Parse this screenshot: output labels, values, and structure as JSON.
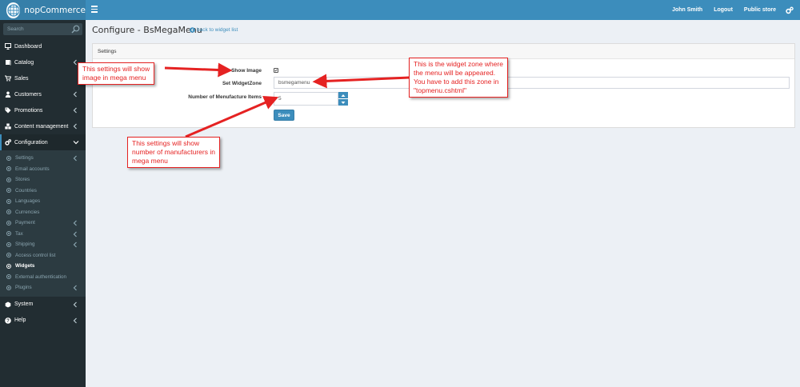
{
  "app": {
    "brand": "nopCommerce"
  },
  "header": {
    "user_name": "John Smith",
    "logout": "Logout",
    "public_store": "Public store"
  },
  "sidebar": {
    "search_placeholder": "Search",
    "items": [
      {
        "label": "Dashboard",
        "icon": "desktop-icon"
      },
      {
        "label": "Catalog",
        "icon": "book-icon"
      },
      {
        "label": "Sales",
        "icon": "cart-icon"
      },
      {
        "label": "Customers",
        "icon": "user-icon"
      },
      {
        "label": "Promotions",
        "icon": "tag-icon"
      },
      {
        "label": "Content management",
        "icon": "cubes-icon"
      },
      {
        "label": "Configuration",
        "icon": "gears-icon"
      },
      {
        "label": "System",
        "icon": "cube-icon"
      },
      {
        "label": "Help",
        "icon": "question-icon"
      }
    ],
    "config_sub": [
      "Settings",
      "Email accounts",
      "Stores",
      "Countries",
      "Languages",
      "Currencies",
      "Payment",
      "Tax",
      "Shipping",
      "Access control list",
      "Widgets",
      "External authentication",
      "Plugins"
    ]
  },
  "page": {
    "title": "Configure - BsMegaMenu",
    "back_link": "back to widget list",
    "panel_heading": "Settings",
    "fields": {
      "show_image_label": "Show Image",
      "show_image_checked": true,
      "widget_zone_label": "Set WidgetZone",
      "widget_zone_value": "bsmegamenu",
      "manufacture_label": "Number of Menufacture Items",
      "manufacture_value": "5"
    },
    "save_label": "Save"
  },
  "callouts": {
    "show_image": [
      "This settings will show",
      "image in mega menu"
    ],
    "widget_zone": [
      "This is the widget zone where",
      "the menu will be appeared.",
      "You have to add this zone in",
      "\"topmenu.cshtml\""
    ],
    "manufacturers": [
      "This settings will show",
      "number of manufacturers in",
      "mega menu"
    ]
  },
  "colors": {
    "header": "#3c8dbc",
    "sidebar": "#222d32",
    "annotation": "#e52222"
  }
}
